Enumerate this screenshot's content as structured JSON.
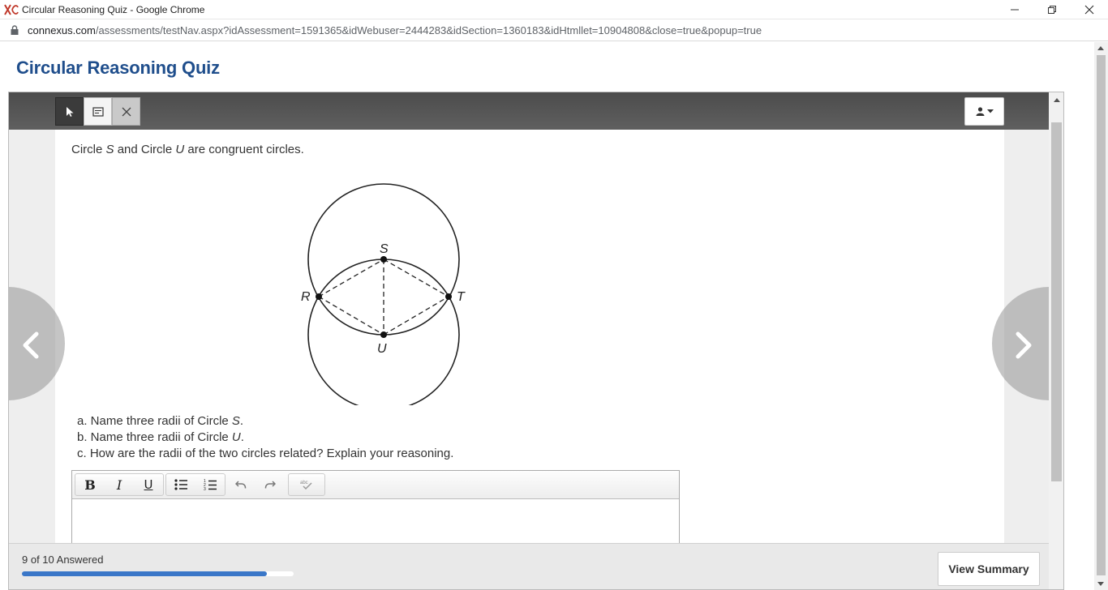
{
  "window": {
    "title": "Circular Reasoning Quiz - Google Chrome"
  },
  "address": {
    "domain": "connexus.com",
    "path": "/assessments/testNav.aspx?idAssessment=1591365&idWebuser=2444283&idSection=1360183&idHtmllet=10904808&close=true&popup=true"
  },
  "page": {
    "title": "Circular Reasoning Quiz"
  },
  "question": {
    "prompt_parts": [
      "Circle ",
      "S",
      " and Circle ",
      "U",
      " are congruent circles."
    ],
    "diagram_labels": {
      "S": "S",
      "R": "R",
      "T": "T",
      "U": "U"
    },
    "items": [
      {
        "prefix": "a. Name three radii of Circle ",
        "var": "S",
        "suffix": "."
      },
      {
        "prefix": "b. Name three radii of Circle ",
        "var": "U",
        "suffix": "."
      },
      {
        "prefix": "c. How are the radii of the two circles related? Explain your reasoning.",
        "var": "",
        "suffix": ""
      }
    ]
  },
  "editor": {
    "bold": "B",
    "italic": "I",
    "underline": "U",
    "icons": [
      "bullet-list-icon",
      "numbered-list-icon",
      "undo-icon",
      "redo-icon",
      "spellcheck-icon"
    ]
  },
  "footer": {
    "progress_text": "9 of 10 Answered",
    "progress_fraction": 0.9,
    "view_summary": "View Summary"
  },
  "colors": {
    "title_blue": "#1f4e8c",
    "progress_blue": "#3a77c8"
  }
}
